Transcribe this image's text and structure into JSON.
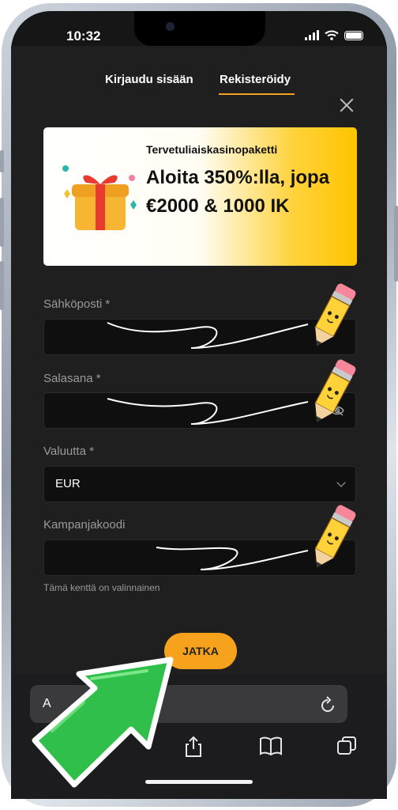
{
  "status": {
    "time": "10:32"
  },
  "nav": {
    "login_tab": "Kirjaudu sisään",
    "register_tab": "Rekisteröidy"
  },
  "banner": {
    "small": "Tervetuliaiskasinopaketti",
    "big": "Aloita 350%:lla, jopa €2000 & 1000 IK"
  },
  "form": {
    "email_label": "Sähköposti *",
    "password_label": "Salasana *",
    "currency_label": "Valuutta *",
    "currency_value": "EUR",
    "promo_label": "Kampanjakoodi",
    "promo_hint": "Tämä kenttä on valinnainen",
    "submit": "JATKA"
  },
  "browser": {
    "url_text": "A"
  },
  "colors": {
    "accent": "#f5a021",
    "button": "#f7a21d",
    "arrow": "#2fbf4a"
  },
  "icons": [
    "close-icon",
    "gift-icon",
    "eye-off-icon",
    "chevron-down-icon",
    "reload-icon",
    "share-icon",
    "bookmarks-icon",
    "tabs-icon",
    "pencil-icon",
    "arrow-pointer"
  ]
}
